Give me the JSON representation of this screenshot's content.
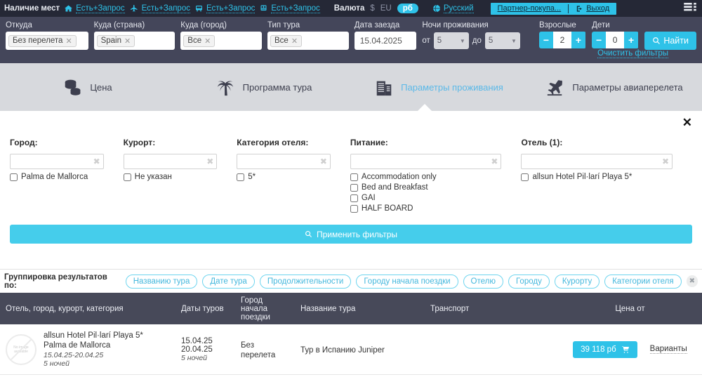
{
  "topbar": {
    "availability_label": "Наличие мест",
    "availability": [
      {
        "icon": "home-icon",
        "text": "Есть+Запрос"
      },
      {
        "icon": "plane-icon",
        "text": "Есть+Запрос"
      },
      {
        "icon": "bus-icon",
        "text": "Есть+Запрос"
      },
      {
        "icon": "train-icon",
        "text": "Есть+Запрос"
      }
    ],
    "currency_label": "Валюта",
    "currencies": [
      {
        "code": "$",
        "active": false
      },
      {
        "code": "EU",
        "active": false
      },
      {
        "code": "рб",
        "active": true
      }
    ],
    "language": "Русский",
    "partner_link": "Партнер-покупа...",
    "logout": "Выход",
    "accent": "#2ec2e8"
  },
  "search": {
    "fields": [
      {
        "label": "Откуда",
        "token": "Без перелета"
      },
      {
        "label": "Куда (страна)",
        "token": "Spain"
      },
      {
        "label": "Куда (город)",
        "token": "Все"
      },
      {
        "label": "Тип тура",
        "token": "Все"
      }
    ],
    "date_label": "Дата заезда",
    "date_value": "15.04.2025",
    "nights_label": "Ночи проживания",
    "nights_from_prefix": "от",
    "nights_from": "5",
    "nights_to_prefix": "до",
    "nights_to": "5",
    "adults_label": "Взрослые",
    "adults_value": "2",
    "children_label": "Дети",
    "children_value": "0",
    "find_label": "Найти",
    "clear_label": "Очистить фильтры",
    "minus": "−",
    "plus": "+"
  },
  "tabs": [
    {
      "label": "Цена",
      "icon": "coins-icon",
      "active": false
    },
    {
      "label": "Программа тура",
      "icon": "palm-icon",
      "active": false
    },
    {
      "label": "Параметры проживания",
      "icon": "building-icon",
      "active": true
    },
    {
      "label": "Параметры авиаперелета",
      "icon": "plane-icon",
      "active": false
    }
  ],
  "filters": {
    "close": "✕",
    "columns": [
      {
        "title": "Город:",
        "options": [
          "Palma de Mallorca"
        ]
      },
      {
        "title": "Курорт:",
        "options": [
          "Не указан"
        ]
      },
      {
        "title": "Категория отеля:",
        "options": [
          "5*"
        ]
      },
      {
        "title": "Питание:",
        "options": [
          "Accommodation only",
          "Bed and Breakfast",
          "GAI",
          "HALF BOARD"
        ]
      },
      {
        "title": "Отель (1):",
        "options": [
          "allsun Hotel Pil·larí Playa 5*"
        ]
      }
    ],
    "apply_label": "Применить фильтры"
  },
  "grouping": {
    "label": "Группировка результатов по:",
    "pills": [
      "Названию тура",
      "Дате тура",
      "Продолжительности",
      "Городу начала поездки",
      "Отелю",
      "Городу",
      "Курорту",
      "Категории отеля"
    ],
    "close": "✖"
  },
  "table": {
    "headers": [
      "Отель, город, курорт, категория",
      "Даты туров",
      "Город начала поездки",
      "Название тура",
      "Транспорт",
      "Цена от"
    ],
    "rows": [
      {
        "thumb_text": "No image available",
        "hotel_name": "allsun Hotel Pil·larí Playa 5*",
        "hotel_city": "Palma de Mallorca",
        "hotel_dates": "15.04.25-20.04.25",
        "hotel_nights": "5 ночей",
        "date_from": "15.04.25",
        "date_to": "20.04.25",
        "nights": "5 ночей",
        "start_city": "Без перелета",
        "tour_name": "Тур в Испанию Juniper",
        "transport": "",
        "price": "39 118  рб",
        "variants": "Варианты"
      }
    ]
  }
}
